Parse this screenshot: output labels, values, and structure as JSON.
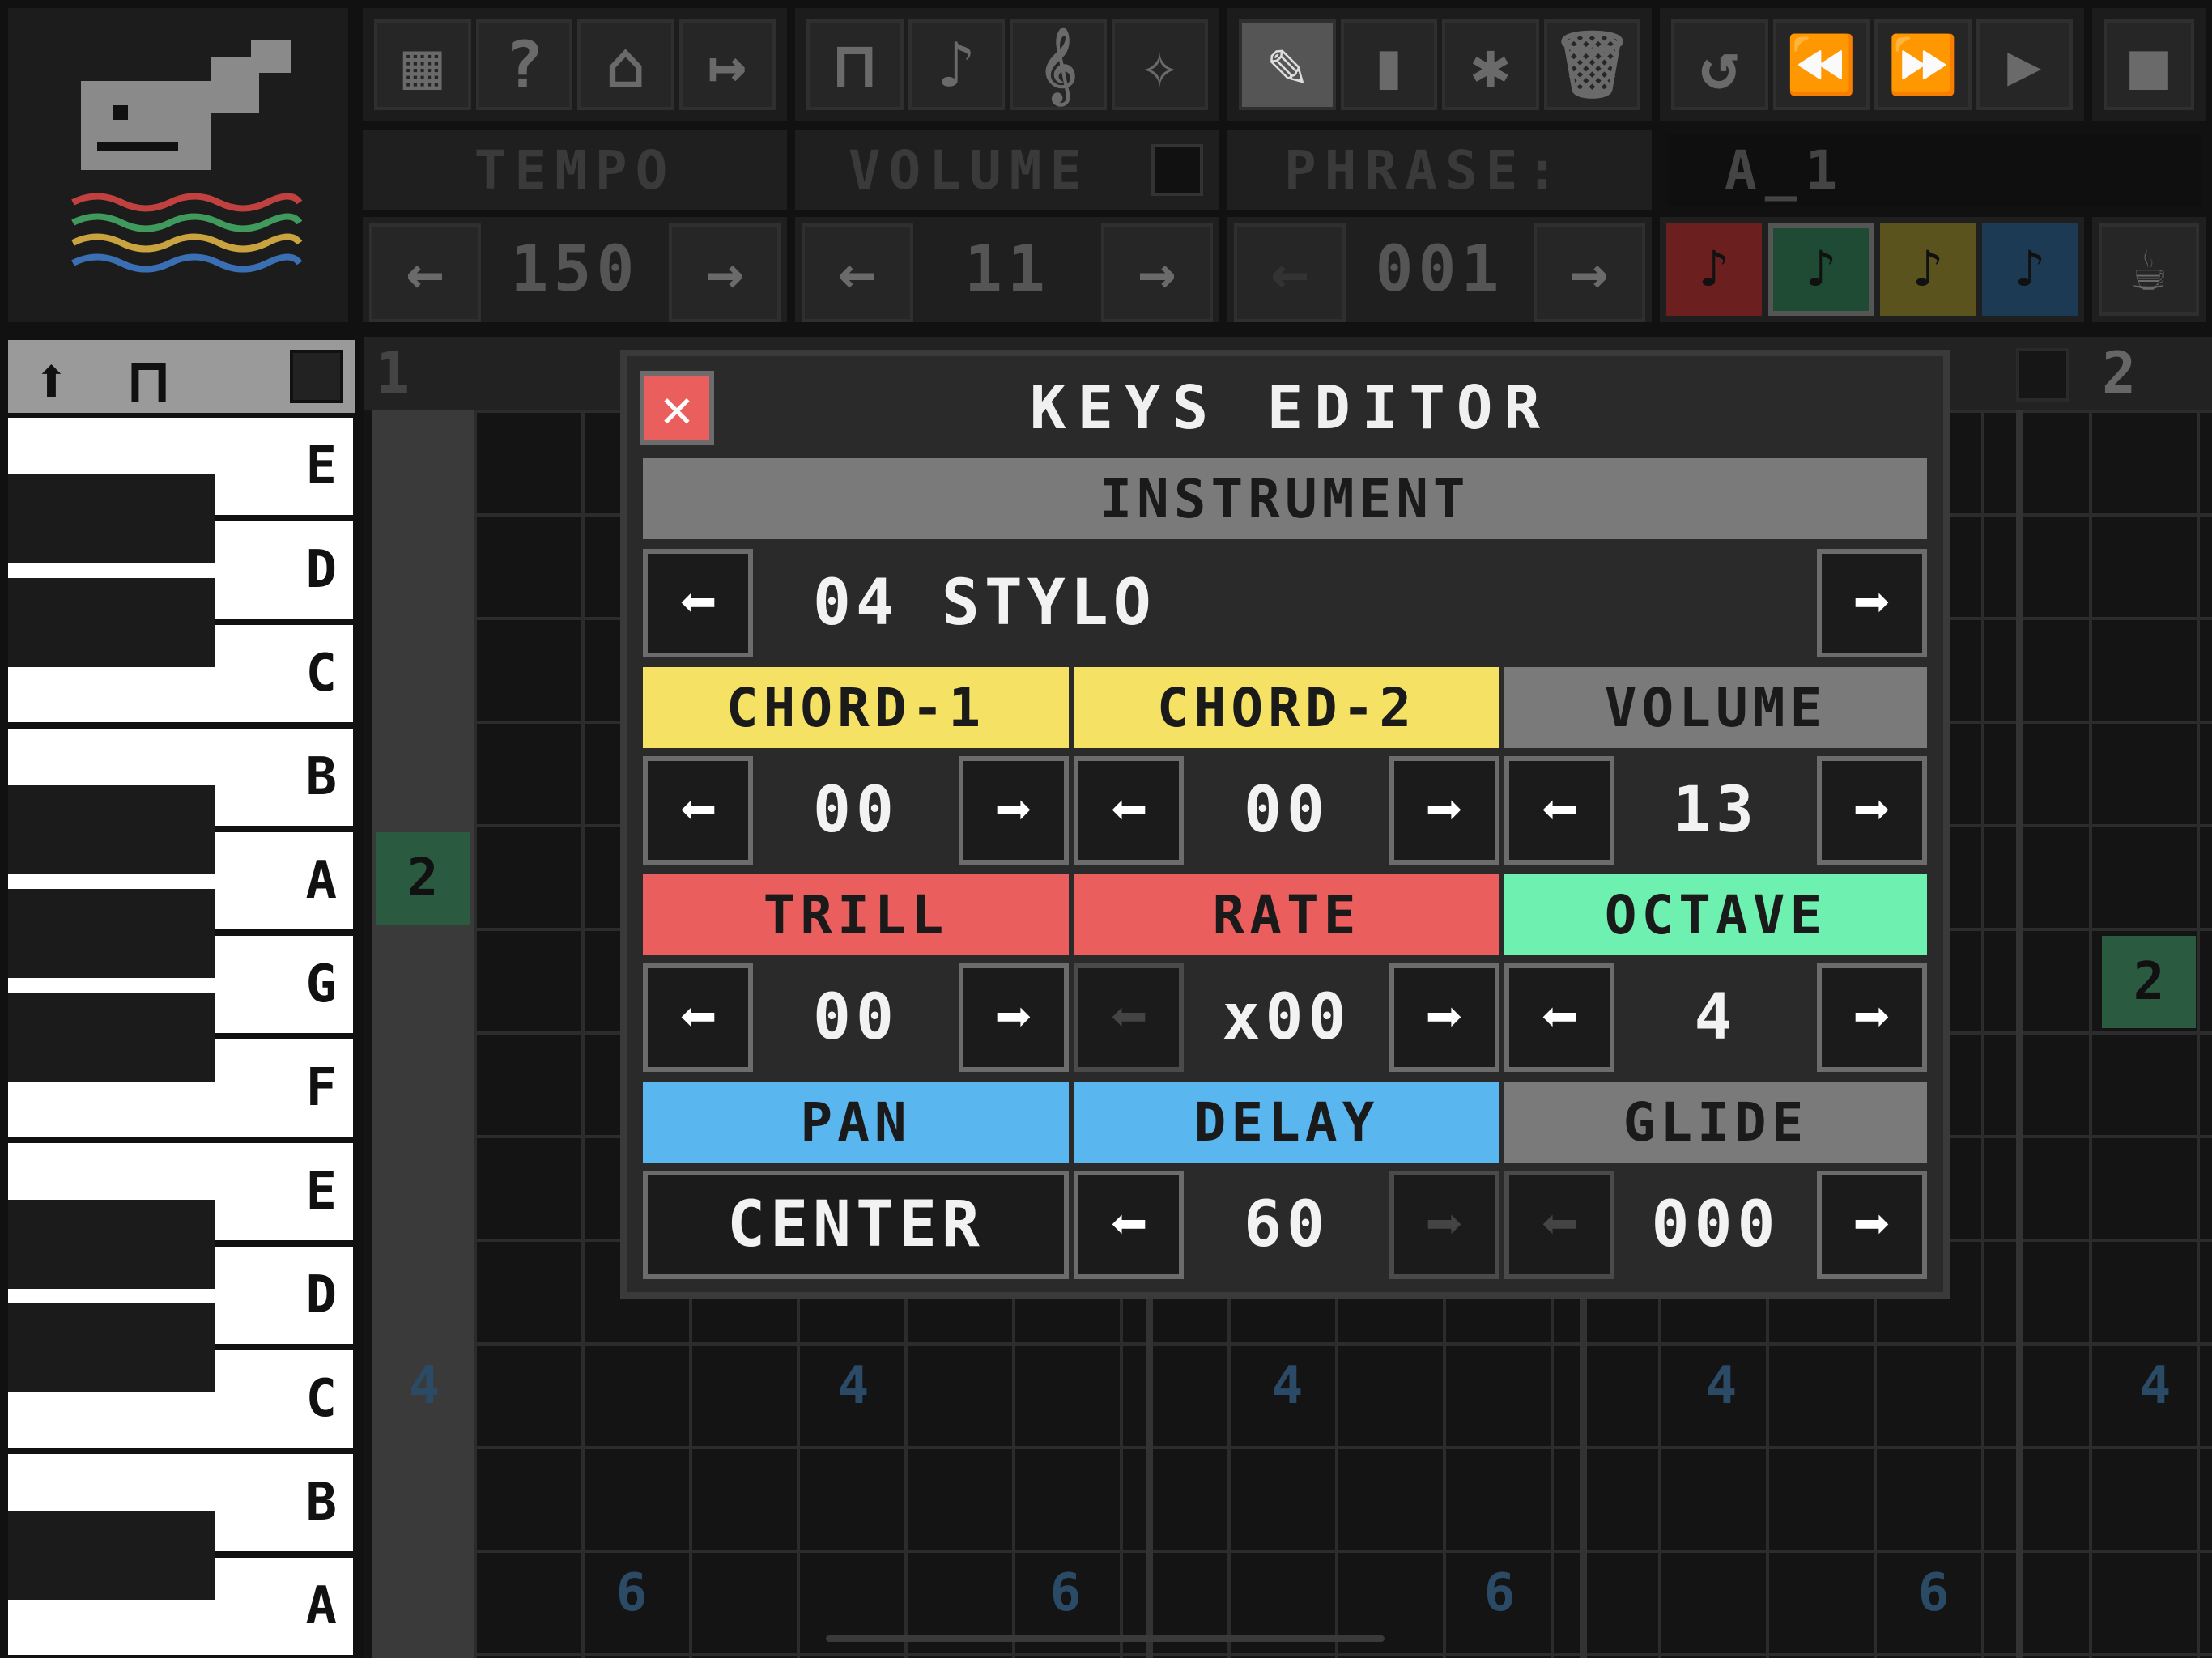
{
  "toolbar": {
    "groups": [
      {
        "icons": [
          "grid-icon",
          "help-icon",
          "save-icon",
          "export-icon"
        ]
      },
      {
        "icons": [
          "keys-icon",
          "wave-icon",
          "clef-icon",
          "bird-icon"
        ]
      },
      {
        "icons": [
          "pencil-icon",
          "eraser-icon",
          "sparkle-icon",
          "trash-icon"
        ]
      },
      {
        "icons": [
          "undo-icon",
          "rewind-icon",
          "forward-icon",
          "play-icon"
        ]
      }
    ],
    "glyphs": {
      "grid": "▦",
      "help": "?",
      "save": "⌂",
      "export": "↦",
      "keys": "⊓",
      "wave": "♪",
      "clef": "𝄞",
      "bird": "✧",
      "pencil": "✎",
      "eraser": "▮",
      "sparkle": "✱",
      "trash": "🗑",
      "undo": "↺",
      "rewind": "⏪",
      "forward": "⏩",
      "play": "▶",
      "stop": "■",
      "cup": "☕"
    }
  },
  "header": {
    "tempo_label": "TEMPO",
    "volume_label": "VOLUME",
    "phrase_label": "PHRASE:",
    "phrase_name": "A_1",
    "tempo_value": "150",
    "volume_value": "11",
    "phrase_value": "001",
    "left_arrow": "←",
    "right_arrow": "→",
    "track_notes": [
      {
        "glyph": "♪",
        "color": "#6b1f1f"
      },
      {
        "glyph": "♪",
        "color": "#1f4a34"
      },
      {
        "glyph": "♪",
        "color": "#5a531e"
      },
      {
        "glyph": "♪",
        "color": "#1d3a55"
      }
    ]
  },
  "keyboard": {
    "up_icon": "⬆",
    "keys_icon": "⊓",
    "notes": [
      "E",
      "D",
      "C",
      "B",
      "A",
      "G",
      "F",
      "E",
      "D",
      "C",
      "B",
      "A"
    ]
  },
  "grid": {
    "track_numbers": [
      "1",
      "2"
    ],
    "blocks": [
      {
        "text": "2",
        "color": "#2a5a40"
      },
      {
        "text": "4",
        "color": "#2a4a66"
      },
      {
        "text": "6",
        "color": "#2a4a66"
      }
    ]
  },
  "editor": {
    "title": "KEYS EDITOR",
    "close_glyph": "✕",
    "instrument_label": "INSTRUMENT",
    "instrument_value": "04 STYLO",
    "chord1_label": "CHORD-1",
    "chord2_label": "CHORD-2",
    "volume_label": "VOLUME",
    "chord1_value": "00",
    "chord2_value": "00",
    "volume_value": "13",
    "trill_label": "TRILL",
    "rate_label": "RATE",
    "octave_label": "OCTAVE",
    "trill_value": "00",
    "rate_value": "x00",
    "octave_value": "4",
    "pan_label": "PAN",
    "delay_label": "DELAY",
    "glide_label": "GLIDE",
    "pan_value": "CENTER",
    "delay_value": "60",
    "glide_value": "000",
    "left_arrow": "⬅",
    "right_arrow": "➡",
    "colors": {
      "yellow": "#f5e264",
      "red": "#ea5e5e",
      "green": "#6ef0b0",
      "blue": "#5ab6ef",
      "gray": "#7a7a7a"
    }
  }
}
